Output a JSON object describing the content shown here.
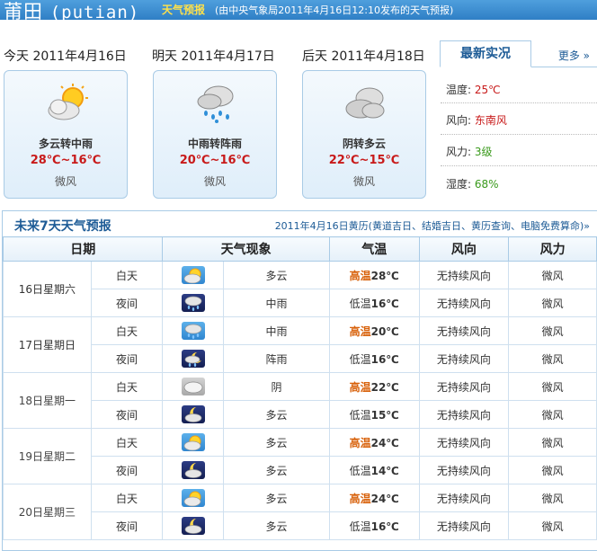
{
  "header": {
    "city": "莆田",
    "city_pinyin": "(putian)",
    "forecast_title": "天气预报",
    "issued": "(由中央气象局2011年4月16日12:10发布的天气预报)"
  },
  "days": [
    {
      "label": "今天",
      "date": "2011年4月16日",
      "icon": "partly-cloudy-icon",
      "condition": "多云转中雨",
      "temp": "28℃~16℃",
      "wind": "微风"
    },
    {
      "label": "明天",
      "date": "2011年4月17日",
      "icon": "rain-icon",
      "condition": "中雨转阵雨",
      "temp": "20℃~16℃",
      "wind": "微风"
    },
    {
      "label": "后天",
      "date": "2011年4月18日",
      "icon": "cloudy-icon",
      "condition": "阴转多云",
      "temp": "22℃~15℃",
      "wind": "微风"
    }
  ],
  "live": {
    "tab": "最新实况",
    "more": "更多 »",
    "rows": [
      {
        "label": "温度:",
        "value": "25℃",
        "color": "#c81a1a"
      },
      {
        "label": "风向:",
        "value": "东南风",
        "color": "#c81a1a"
      },
      {
        "label": "风力:",
        "value": "3级",
        "color": "#3a9a1c"
      },
      {
        "label": "湿度:",
        "value": "68%",
        "color": "#3a9a1c"
      }
    ]
  },
  "week": {
    "title": "未来7天天气预报",
    "links": "2011年4月16日黄历(黄道吉日、结婚吉日、黄历查询、电脑免费算命)»",
    "headers": [
      "日期",
      "天气现象",
      "气温",
      "风向",
      "风力"
    ],
    "rows": [
      {
        "date": "16日星期六",
        "red": true,
        "periods": [
          {
            "period": "白天",
            "icon": "sun-cloud-icon",
            "icon_style": "day",
            "weather": "多云",
            "temp_label": "高温",
            "temp": "28℃",
            "wind_dir": "无持续风向",
            "wind_force": "微风"
          },
          {
            "period": "夜间",
            "icon": "rain-icon",
            "icon_style": "night",
            "weather": "中雨",
            "temp_label": "低温",
            "temp": "16℃",
            "wind_dir": "无持续风向",
            "wind_force": "微风"
          }
        ]
      },
      {
        "date": "17日星期日",
        "red": true,
        "periods": [
          {
            "period": "白天",
            "icon": "rain-icon",
            "icon_style": "day",
            "weather": "中雨",
            "temp_label": "高温",
            "temp": "20℃",
            "wind_dir": "无持续风向",
            "wind_force": "微风"
          },
          {
            "period": "夜间",
            "icon": "moon-rain-icon",
            "icon_style": "night",
            "weather": "阵雨",
            "temp_label": "低温",
            "temp": "16℃",
            "wind_dir": "无持续风向",
            "wind_force": "微风"
          }
        ]
      },
      {
        "date": "18日星期一",
        "red": false,
        "periods": [
          {
            "period": "白天",
            "icon": "overcast-icon",
            "icon_style": "grey",
            "weather": "阴",
            "temp_label": "高温",
            "temp": "22℃",
            "wind_dir": "无持续风向",
            "wind_force": "微风"
          },
          {
            "period": "夜间",
            "icon": "moon-cloud-icon",
            "icon_style": "night",
            "weather": "多云",
            "temp_label": "低温",
            "temp": "15℃",
            "wind_dir": "无持续风向",
            "wind_force": "微风"
          }
        ]
      },
      {
        "date": "19日星期二",
        "red": false,
        "periods": [
          {
            "period": "白天",
            "icon": "sun-cloud-icon",
            "icon_style": "day",
            "weather": "多云",
            "temp_label": "高温",
            "temp": "24℃",
            "wind_dir": "无持续风向",
            "wind_force": "微风"
          },
          {
            "period": "夜间",
            "icon": "moon-cloud-icon",
            "icon_style": "night",
            "weather": "多云",
            "temp_label": "低温",
            "temp": "14℃",
            "wind_dir": "无持续风向",
            "wind_force": "微风"
          }
        ]
      },
      {
        "date": "20日星期三",
        "red": false,
        "periods": [
          {
            "period": "白天",
            "icon": "sun-cloud-icon",
            "icon_style": "day",
            "weather": "多云",
            "temp_label": "高温",
            "temp": "24℃",
            "wind_dir": "无持续风向",
            "wind_force": "微风"
          },
          {
            "period": "夜间",
            "icon": "moon-cloud-icon",
            "icon_style": "night",
            "weather": "多云",
            "temp_label": "低温",
            "temp": "16℃",
            "wind_dir": "无持续风向",
            "wind_force": "微风"
          }
        ]
      }
    ]
  }
}
